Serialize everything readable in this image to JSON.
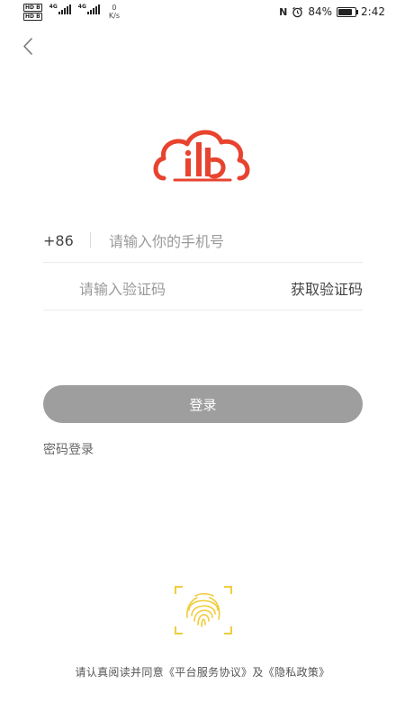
{
  "status_bar": {
    "net_badges": [
      "HD B",
      "HD B"
    ],
    "signal1_label": "4G",
    "signal2_label": "4G",
    "speed_value": "0",
    "speed_unit": "K/s",
    "nfc_label": "N",
    "battery_percent": "84%",
    "battery_level": 0.84,
    "time": "2:42"
  },
  "login": {
    "country_code": "+86",
    "phone_placeholder": "请输入你的手机号",
    "code_placeholder": "请输入验证码",
    "get_code_label": "获取验证码",
    "login_button": "登录",
    "password_login_link": "密码登录"
  },
  "footer": {
    "agreement_prefix": "请认真阅读并同意",
    "platform_agreement": "《平台服务协议》",
    "conjunction": "及",
    "privacy_policy": "《隐私政策》"
  },
  "colors": {
    "brand_red": "#e8432f",
    "button_gray": "#9e9e9e",
    "fingerprint_yellow": "#f2cc3c"
  },
  "icons": [
    "back-chevron-icon",
    "app-logo",
    "fingerprint-icon",
    "alarm-icon",
    "battery-icon",
    "nfc-icon",
    "signal-icon"
  ]
}
